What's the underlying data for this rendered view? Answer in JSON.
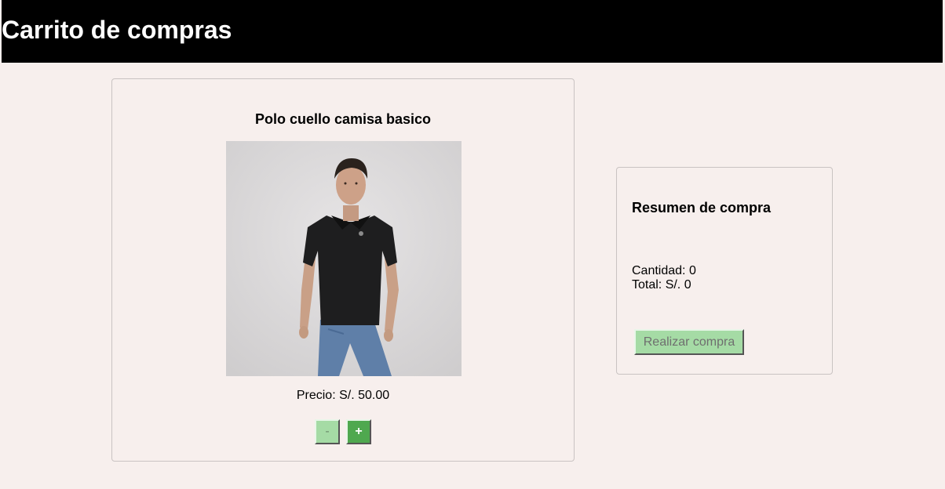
{
  "header": {
    "title": "Carrito de compras"
  },
  "product": {
    "name": "Polo cuello camisa basico",
    "image_alt_icon": "product-photo",
    "price_label": "Precio: S/. 50.00",
    "decrement_label": "-",
    "increment_label": "+"
  },
  "summary": {
    "title": "Resumen de compra",
    "quantity_label": "Cantidad: 0",
    "total_label": "Total: S/. 0",
    "checkout_label": "Realizar compra"
  },
  "colors": {
    "header_bg": "#000000",
    "page_bg": "#f7efed",
    "button_light_green": "#a5dba5",
    "button_dark_green": "#4fa84f"
  }
}
